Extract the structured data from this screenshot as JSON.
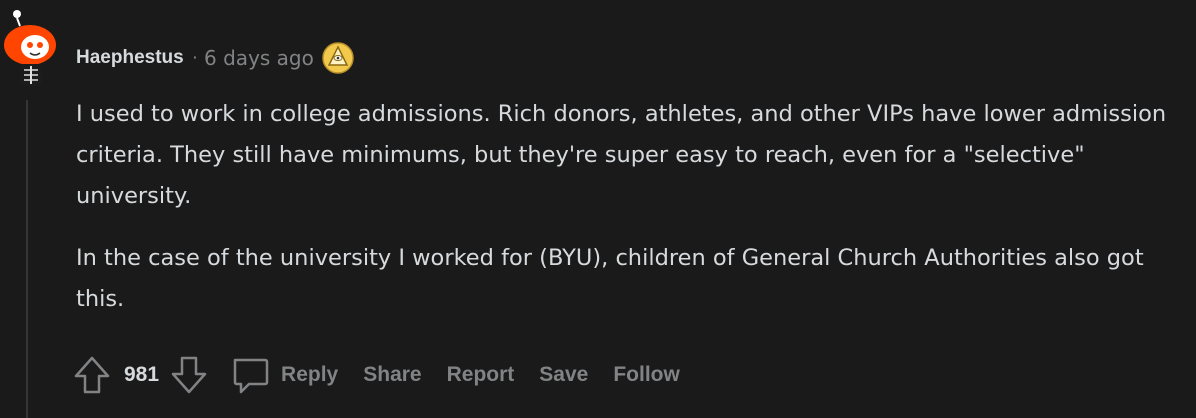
{
  "comment": {
    "username": "Haephestus",
    "separator": "·",
    "timestamp": "6 days ago",
    "award_icon": "award-icon",
    "avatar_icon": "snoo-avatar",
    "body": [
      "I used to work in college admissions. Rich donors, athletes, and other VIPs have lower admission criteria. They still have minimums, but they're super easy to reach, even for a \"selective\" university.",
      "In the case of the university I worked for (BYU), children of General Church Authorities also got this."
    ]
  },
  "actions": {
    "upvote_icon": "upvote-arrow-icon",
    "score": "981",
    "downvote_icon": "downvote-arrow-icon",
    "reply_icon": "speech-bubble-icon",
    "reply_label": "Reply",
    "share_label": "Share",
    "report_label": "Report",
    "save_label": "Save",
    "follow_label": "Follow"
  },
  "colors": {
    "background": "#1a1a1b",
    "text": "#d7dadc",
    "muted": "#818384",
    "thread_line": "#343536",
    "avatar_orange": "#ff4500",
    "award_gold": "#f2c94c"
  }
}
